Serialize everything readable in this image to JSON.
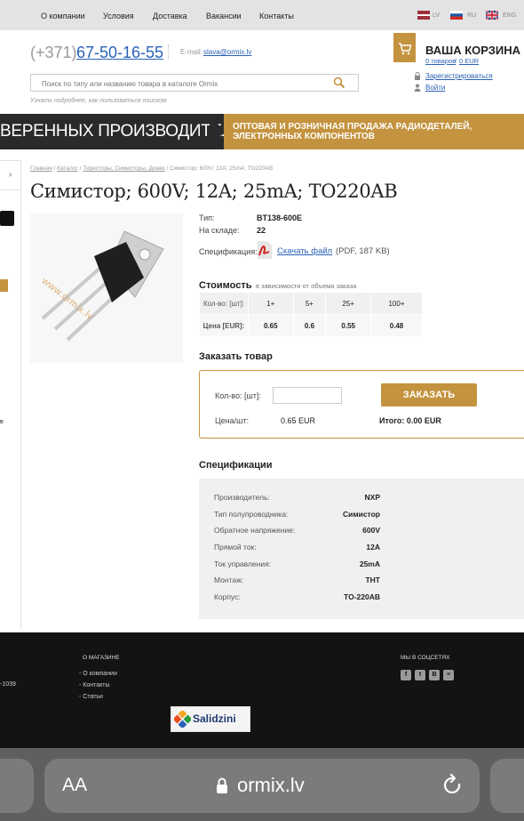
{
  "topnav": {
    "links": [
      "О компании",
      "Условия",
      "Доставка",
      "Вакансии",
      "Контакты"
    ],
    "langs": [
      "LV",
      "RU",
      "ENG"
    ]
  },
  "header": {
    "phone_prefix": "(+371)",
    "phone": "67-50-16-55",
    "email_label": "E-mail:",
    "email": "slava@ormix.lv",
    "search_placeholder": "Поиск по типу или названию товара в каталоге Ormix",
    "search_hint": "Узнать подробнее, как пользоваться поиском",
    "cart_title": "ВАША КОРЗИНА",
    "cart_items": "0 товаров",
    "cart_sep": "/",
    "cart_sum": "0 EUR",
    "register": "Зарегистрироваться",
    "login": "Войти"
  },
  "banner": {
    "left_text": "ВЕРЕННЫХ ПРОИЗВОДИТЕЛЕЙ",
    "right_line1": "ОПТОВАЯ И РОЗНИЧНАЯ ПРОДАЖА РАДИОДЕТАЛЕЙ,",
    "right_line2": "ЭЛЕКТРОННЫХ КОМПОНЕНТОВ"
  },
  "left_col": {
    "arrow": "›",
    "fragment": "в"
  },
  "breadcrumb": [
    "Главная",
    "Каталог",
    "Тиристоры, Симисторы, Диаки",
    "Симистор; 600V; 12A; 25mA; TO220AB"
  ],
  "product": {
    "title": "Симистор; 600V; 12A; 25mA; TO220AB",
    "watermark": "www.ormix.lv",
    "type_label": "Тип:",
    "type_value": "BT138-600E",
    "stock_label": "На складе:",
    "stock_value": "22",
    "spec_label": "Спецификация:",
    "download": "Скачать файл",
    "pdf_info": "(PDF, 187 KB)"
  },
  "price": {
    "title": "Стоимость",
    "subtitle": "в зависимости от объема заказа",
    "qty_label": "Кол-во: [шт]:",
    "price_label": "Цена [EUR]:",
    "tiers": [
      "1+",
      "5+",
      "25+",
      "100+"
    ],
    "prices": [
      "0.65",
      "0.6",
      "0.55",
      "0.48"
    ]
  },
  "order": {
    "title": "Заказать товар",
    "qty_label": "Кол-во: [шт]:",
    "button": "ЗАКАЗАТЬ",
    "unit_label": "Цена/шт:",
    "unit_value": "0.65 EUR",
    "total": "Итого: 0.00 EUR"
  },
  "specs": {
    "title": "Спецификации",
    "rows": [
      {
        "k": "Производитель:",
        "v": "NXP"
      },
      {
        "k": "Тип полупроводника:",
        "v": "Симистор"
      },
      {
        "k": "Обратное напряжение:",
        "v": "600V"
      },
      {
        "k": "Прямой ток:",
        "v": "12A"
      },
      {
        "k": "Ток управления:",
        "v": "25mA"
      },
      {
        "k": "Монтаж:",
        "v": "THT"
      },
      {
        "k": "Корпус:",
        "v": "TO-220AB"
      }
    ]
  },
  "footer": {
    "phone_fragment": "-1039",
    "about_title": "О МАГАЗИНЕ",
    "about_links": [
      "- О компании",
      "- Контакты",
      "- Статьи"
    ],
    "social_title": "МЫ В СОЦСЕТЯХ",
    "social": [
      "f",
      "t",
      "B",
      "≡"
    ],
    "salidzini": "Salidzini"
  },
  "browser": {
    "aa": "AA",
    "url": "ormix.lv"
  },
  "colors": {
    "accent": "#c4933f",
    "link": "#2a62b8",
    "footer": "#131313"
  }
}
